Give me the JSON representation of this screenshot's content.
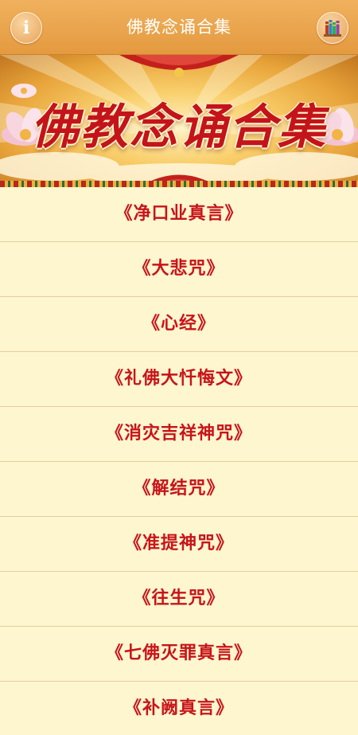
{
  "header": {
    "title": "佛教念诵合集",
    "info_icon_glyph": "i",
    "left_icon": "info-icon",
    "right_icon": "books-icon"
  },
  "banner": {
    "title": "佛教念诵合集"
  },
  "list": {
    "items": [
      {
        "label": "《净口业真言》"
      },
      {
        "label": "《大悲咒》"
      },
      {
        "label": "《心经》"
      },
      {
        "label": "《礼佛大忏悔文》"
      },
      {
        "label": "《消灾吉祥神咒》"
      },
      {
        "label": "《解结咒》"
      },
      {
        "label": "《准提神咒》"
      },
      {
        "label": "《往生咒》"
      },
      {
        "label": "《七佛灭罪真言》"
      },
      {
        "label": "《补阙真言》"
      }
    ]
  },
  "colors": {
    "header_bg": "#e9a54c",
    "list_bg": "#fdf6cf",
    "item_text": "#c8141a",
    "divider": "#e5cda0"
  }
}
